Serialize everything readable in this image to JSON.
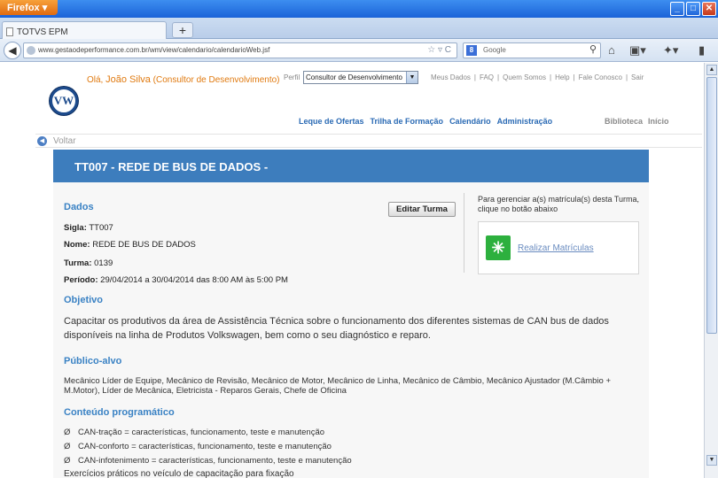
{
  "browser": {
    "app_button": "Firefox",
    "tab_title": "TOTVS EPM",
    "new_tab": "+",
    "url": "www.gestaodeperformance.com.br/wm/view/calendario/calendarioWeb.jsf",
    "search_placeholder": "Google",
    "search_engine_letter": "8"
  },
  "header": {
    "greeting_prefix": "Olá, ",
    "user_name": "João Silva",
    "user_role": "(Consultor de Desenvolvimento)",
    "perfil_label": "Perfil",
    "perfil_value": "Consultor de Desenvolvimento",
    "top_links": [
      "Meus Dados",
      "FAQ",
      "Quem Somos",
      "Help",
      "Fale Conosco",
      "Sair"
    ],
    "logo_text": "VW"
  },
  "main_menu": [
    "Leque de Ofertas",
    "Trilha de Formação",
    "Calendário",
    "Administração"
  ],
  "right_menu": [
    "Biblioteca",
    "Início"
  ],
  "back_label": "Voltar",
  "banner_title": "TT007 - REDE DE BUS DE DADOS -",
  "dados": {
    "heading": "Dados",
    "sigla_label": "Sigla:",
    "sigla": "TT007",
    "nome_label": "Nome:",
    "nome": "REDE DE BUS DE DADOS",
    "turma_label": "Turma:",
    "turma": "0139",
    "periodo_label": "Período:",
    "periodo": "29/04/2014 a 30/04/2014 das 8:00 AM às 5:00 PM",
    "edit_button": "Editar Turma"
  },
  "matriculas": {
    "text": "Para gerenciar a(s) matrícula(s) desta Turma, clique no botão abaixo",
    "link": "Realizar Matrículas"
  },
  "objetivo": {
    "heading": "Objetivo",
    "text": "Capacitar os produtivos da área de Assistência Técnica sobre o funcionamento dos diferentes sistemas de CAN bus de dados disponíveis na linha de Produtos Volkswagen, bem como o seu diagnóstico e reparo."
  },
  "publico": {
    "heading": "Público-alvo",
    "text": "Mecânico Líder de Equipe, Mecânico de Revisão, Mecânico de Motor, Mecânico de Linha, Mecânico de Câmbio, Mecânico Ajustador (M.Câmbio + M.Motor), Líder de Mecânica, Eletricista - Reparos Gerais, Chefe de Oficina"
  },
  "conteudo": {
    "heading": "Conteúdo programático",
    "bullet_symbol": "Ø",
    "items": [
      "CAN-tração = características, funcionamento, teste e manutenção",
      "CAN-conforto = características, funcionamento, teste e manutenção",
      "CAN-infotenimento = características, funcionamento, teste e manutenção",
      "Exercícios práticos no veículo de capacitação para fixação"
    ]
  }
}
